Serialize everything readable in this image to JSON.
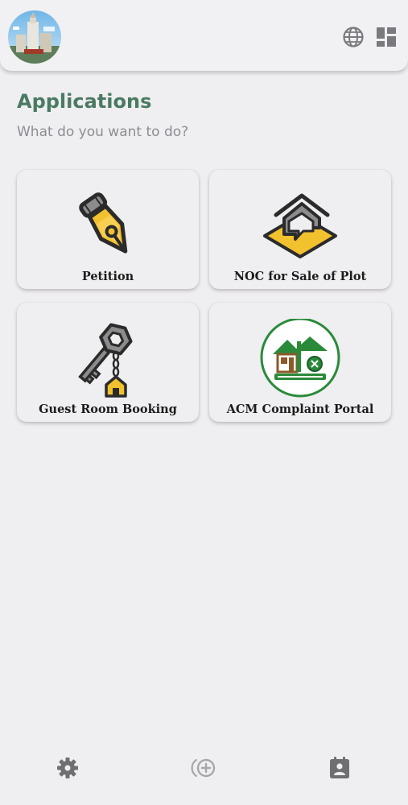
{
  "header": {
    "avatar": "avatar-building-photo",
    "language_icon": "globe-icon",
    "layout_icon": "grid-layout-icon"
  },
  "section": {
    "title": "Applications",
    "subtitle": "What do you want to do?"
  },
  "cards": [
    {
      "label": "Petition",
      "icon": "fountain-pen-icon"
    },
    {
      "label": "NOC for Sale of Plot",
      "icon": "house-sign-icon"
    },
    {
      "label": "Guest Room Booking",
      "icon": "key-house-icon"
    },
    {
      "label": "ACM Complaint Portal",
      "icon": "housing-directorate-logo"
    }
  ],
  "bottom_nav": [
    {
      "icon": "settings-gear-icon"
    },
    {
      "icon": "add-circle-icon"
    },
    {
      "icon": "contact-card-icon"
    }
  ],
  "colors": {
    "background": "#efeef0",
    "title_green": "#4a7a63",
    "subtitle_gray": "#8d8d92",
    "icon_gray": "#6f6f72",
    "accent_yellow": "#f2c12e",
    "logo_green": "#2a8a3a"
  }
}
